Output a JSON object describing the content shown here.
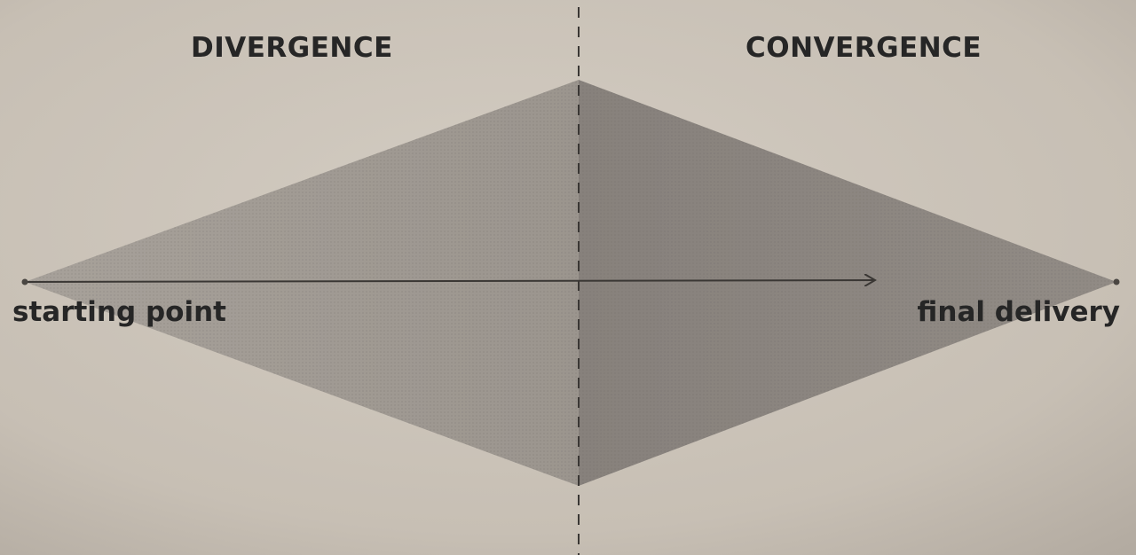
{
  "diagram": {
    "left_heading": "DIVERGENCE",
    "right_heading": "CONVERGENCE",
    "start_label": "starting point",
    "end_label": "final delivery"
  },
  "colors": {
    "paper": "#c9c1b6",
    "divergence_fill": "#9f9992",
    "convergence_fill": "#8b8580",
    "ink": "#262626"
  }
}
